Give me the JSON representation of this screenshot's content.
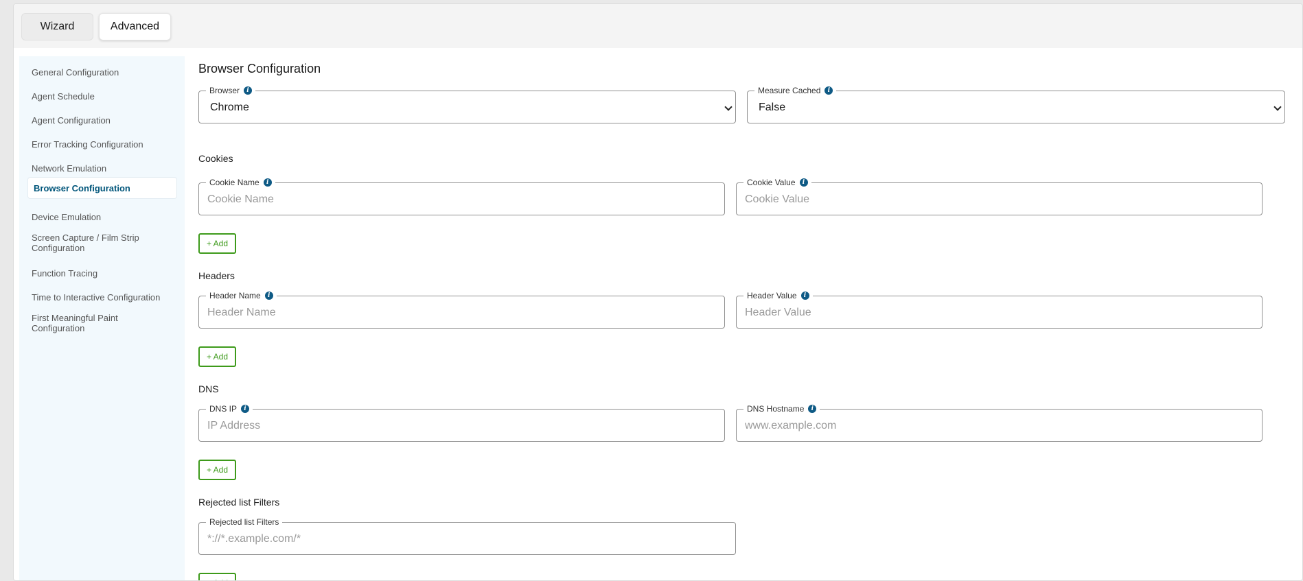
{
  "tabs": {
    "wizard": "Wizard",
    "advanced": "Advanced"
  },
  "sidebar": {
    "items": [
      {
        "label": "General Configuration"
      },
      {
        "label": "Agent Schedule"
      },
      {
        "label": "Agent Configuration"
      },
      {
        "label": "Error Tracking Configuration"
      },
      {
        "label": "Network Emulation"
      },
      {
        "label": "Browser Configuration",
        "active": true
      },
      {
        "label": "Device Emulation"
      },
      {
        "label": "Screen Capture / Film Strip Configuration"
      },
      {
        "label": "Function Tracing"
      },
      {
        "label": "Time to Interactive Configuration"
      },
      {
        "label": "First Meaningful Paint Configuration"
      }
    ]
  },
  "main": {
    "title": "Browser Configuration",
    "browser": {
      "label": "Browser",
      "value": "Chrome"
    },
    "measure_cached": {
      "label": "Measure Cached",
      "value": "False"
    },
    "cookies": {
      "heading": "Cookies",
      "name_label": "Cookie Name",
      "name_placeholder": "Cookie Name",
      "value_label": "Cookie Value",
      "value_placeholder": "Cookie Value",
      "add": "+ Add"
    },
    "headers": {
      "heading": "Headers",
      "name_label": "Header Name",
      "name_placeholder": "Header Name",
      "value_label": "Header Value",
      "value_placeholder": "Header Value",
      "add": "+ Add"
    },
    "dns": {
      "heading": "DNS",
      "ip_label": "DNS IP",
      "ip_placeholder": "IP Address",
      "host_label": "DNS Hostname",
      "host_placeholder": "www.example.com",
      "add": "+ Add"
    },
    "rejected": {
      "heading": "Rejected list Filters",
      "label": "Rejected list Filters",
      "placeholder": "*://*.example.com/*",
      "add": "+ Add"
    }
  },
  "colors": {
    "accent": "#00557a",
    "add_green": "#3d9a1a",
    "sidebar_bg": "#f2f9fd",
    "info_icon": "#0e5a85"
  }
}
